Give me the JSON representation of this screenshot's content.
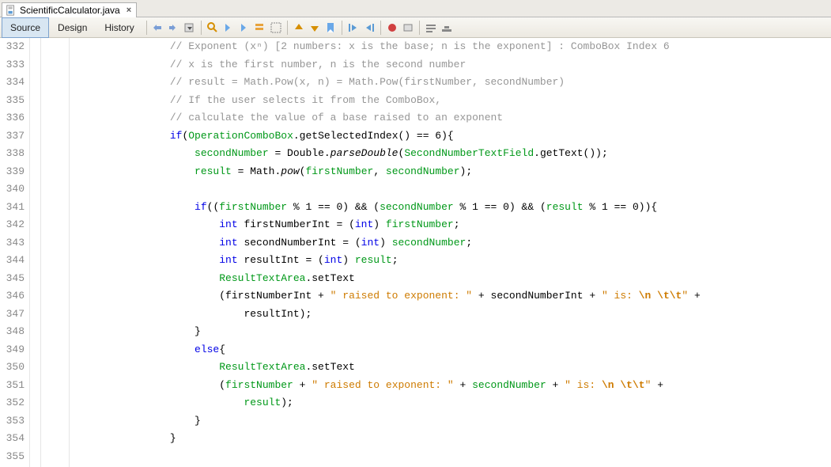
{
  "tab": {
    "filename": "ScientificCalculator.java"
  },
  "toolbar": {
    "source": "Source",
    "design": "Design",
    "history": "History"
  },
  "gutter": {
    "start": 332,
    "end": 355
  },
  "code": {
    "lines": [
      {
        "indent": 4,
        "segs": [
          {
            "t": "// Exponent (xⁿ) [2 numbers: x is the base; n is the exponent] : ComboBox Index 6",
            "c": "c-comment"
          }
        ]
      },
      {
        "indent": 4,
        "segs": [
          {
            "t": "// x is the first number, n is the second number",
            "c": "c-comment"
          }
        ]
      },
      {
        "indent": 4,
        "segs": [
          {
            "t": "// result = Math.Pow(x, n) = Math.Pow(firstNumber, secondNumber)",
            "c": "c-comment"
          }
        ]
      },
      {
        "indent": 4,
        "segs": [
          {
            "t": "// If the user selects it from the ComboBox,",
            "c": "c-comment"
          }
        ]
      },
      {
        "indent": 4,
        "segs": [
          {
            "t": "// calculate the value of a base raised to an exponent",
            "c": "c-comment"
          }
        ]
      },
      {
        "indent": 4,
        "segs": [
          {
            "t": "if",
            "c": "c-kw"
          },
          {
            "t": "("
          },
          {
            "t": "OperationComboBox",
            "c": "c-field"
          },
          {
            "t": ".getSelectedIndex() == 6){"
          }
        ]
      },
      {
        "indent": 5,
        "segs": [
          {
            "t": "secondNumber",
            "c": "c-field"
          },
          {
            "t": " = Double."
          },
          {
            "t": "parseDouble",
            "c": "c-method-static"
          },
          {
            "t": "("
          },
          {
            "t": "SecondNumberTextField",
            "c": "c-field"
          },
          {
            "t": ".getText());"
          }
        ]
      },
      {
        "indent": 5,
        "segs": [
          {
            "t": "result",
            "c": "c-field"
          },
          {
            "t": " = Math."
          },
          {
            "t": "pow",
            "c": "c-method-static"
          },
          {
            "t": "("
          },
          {
            "t": "firstNumber",
            "c": "c-field"
          },
          {
            "t": ", "
          },
          {
            "t": "secondNumber",
            "c": "c-field"
          },
          {
            "t": ");"
          }
        ]
      },
      {
        "indent": 0,
        "segs": []
      },
      {
        "indent": 5,
        "segs": [
          {
            "t": "if",
            "c": "c-kw"
          },
          {
            "t": "(("
          },
          {
            "t": "firstNumber",
            "c": "c-field"
          },
          {
            "t": " % 1 == 0) && ("
          },
          {
            "t": "secondNumber",
            "c": "c-field"
          },
          {
            "t": " % 1 == 0) && ("
          },
          {
            "t": "result",
            "c": "c-field"
          },
          {
            "t": " % 1 == 0)){"
          }
        ]
      },
      {
        "indent": 6,
        "segs": [
          {
            "t": "int",
            "c": "c-kw"
          },
          {
            "t": " firstNumberInt = ("
          },
          {
            "t": "int",
            "c": "c-kw"
          },
          {
            "t": ") "
          },
          {
            "t": "firstNumber",
            "c": "c-field"
          },
          {
            "t": ";"
          }
        ]
      },
      {
        "indent": 6,
        "segs": [
          {
            "t": "int",
            "c": "c-kw"
          },
          {
            "t": " secondNumberInt = ("
          },
          {
            "t": "int",
            "c": "c-kw"
          },
          {
            "t": ") "
          },
          {
            "t": "secondNumber",
            "c": "c-field"
          },
          {
            "t": ";"
          }
        ]
      },
      {
        "indent": 6,
        "segs": [
          {
            "t": "int",
            "c": "c-kw"
          },
          {
            "t": " resultInt = ("
          },
          {
            "t": "int",
            "c": "c-kw"
          },
          {
            "t": ") "
          },
          {
            "t": "result",
            "c": "c-field"
          },
          {
            "t": ";"
          }
        ]
      },
      {
        "indent": 6,
        "segs": [
          {
            "t": "ResultTextArea",
            "c": "c-field"
          },
          {
            "t": ".setText"
          }
        ]
      },
      {
        "indent": 6,
        "segs": [
          {
            "t": "(firstNumberInt + "
          },
          {
            "t": "\" raised to exponent: \"",
            "c": "c-str"
          },
          {
            "t": " + secondNumberInt + "
          },
          {
            "t": "\" is: ",
            "c": "c-str"
          },
          {
            "t": "\\n \\t\\t",
            "c": "c-esc"
          },
          {
            "t": "\"",
            "c": "c-str"
          },
          {
            "t": " + "
          }
        ]
      },
      {
        "indent": 7,
        "segs": [
          {
            "t": "resultInt);"
          }
        ]
      },
      {
        "indent": 5,
        "segs": [
          {
            "t": "}"
          }
        ]
      },
      {
        "indent": 5,
        "segs": [
          {
            "t": "else",
            "c": "c-kw"
          },
          {
            "t": "{"
          }
        ]
      },
      {
        "indent": 6,
        "segs": [
          {
            "t": "ResultTextArea",
            "c": "c-field"
          },
          {
            "t": ".setText"
          }
        ]
      },
      {
        "indent": 6,
        "segs": [
          {
            "t": "("
          },
          {
            "t": "firstNumber",
            "c": "c-field"
          },
          {
            "t": " + "
          },
          {
            "t": "\" raised to exponent: \"",
            "c": "c-str"
          },
          {
            "t": " + "
          },
          {
            "t": "secondNumber",
            "c": "c-field"
          },
          {
            "t": " + "
          },
          {
            "t": "\" is: ",
            "c": "c-str"
          },
          {
            "t": "\\n \\t\\t",
            "c": "c-esc"
          },
          {
            "t": "\"",
            "c": "c-str"
          },
          {
            "t": " + "
          }
        ]
      },
      {
        "indent": 7,
        "segs": [
          {
            "t": "result",
            "c": "c-field"
          },
          {
            "t": ");"
          }
        ]
      },
      {
        "indent": 5,
        "segs": [
          {
            "t": "}"
          }
        ]
      },
      {
        "indent": 4,
        "segs": [
          {
            "t": "}"
          }
        ]
      },
      {
        "indent": 0,
        "segs": []
      }
    ]
  }
}
